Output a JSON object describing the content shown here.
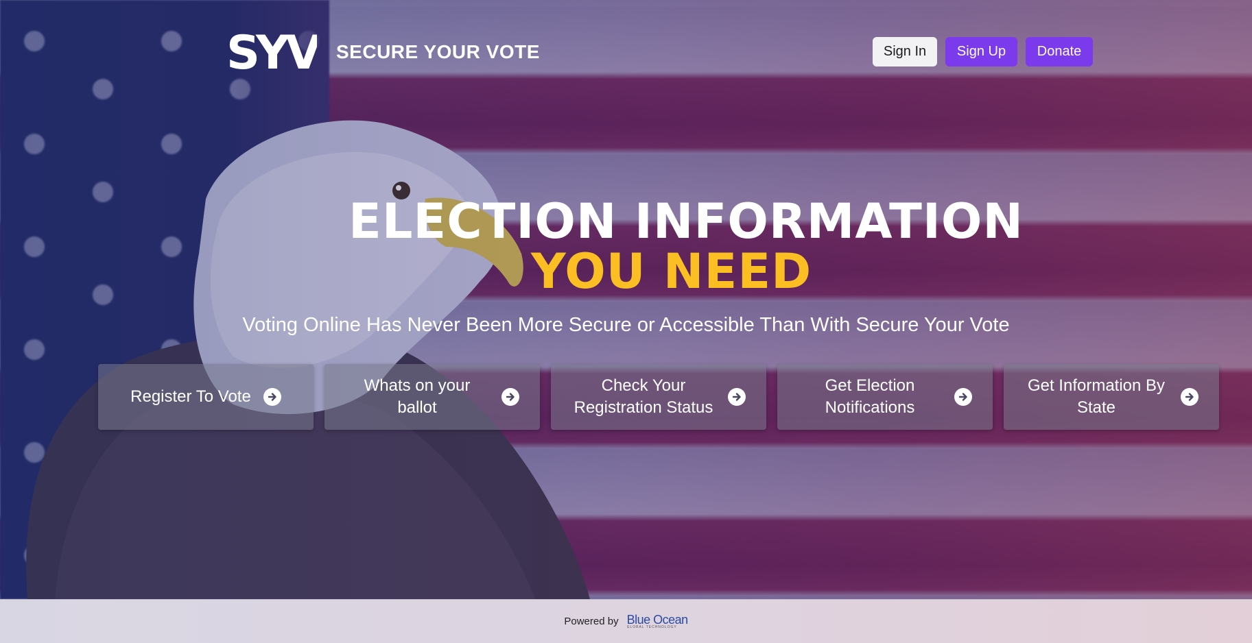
{
  "header": {
    "logo_text": "SYV",
    "brand_name": "SECURE YOUR VOTE",
    "nav": {
      "sign_in": "Sign In",
      "sign_up": "Sign Up",
      "donate": "Donate"
    }
  },
  "hero": {
    "title_line1": "ELECTION INFORMATION",
    "title_line2": "YOU NEED",
    "subtitle": "Voting Online Has Never Been More Secure or Accessible Than With Secure Your Vote"
  },
  "cards": [
    {
      "label": "Register To Vote",
      "icon": "arrow-right-circle-icon"
    },
    {
      "label": "Whats on your ballot",
      "icon": "arrow-right-circle-icon"
    },
    {
      "label": "Check Your Registration Status",
      "icon": "arrow-right-circle-icon"
    },
    {
      "label": "Get Election Notifications",
      "icon": "arrow-right-circle-icon"
    },
    {
      "label": "Get Information By State",
      "icon": "arrow-right-circle-icon"
    }
  ],
  "footer": {
    "powered_by": "Powered by",
    "brand": "Blue Ocean",
    "brand_sub": "GLOBAL TECHNOLOGY"
  },
  "colors": {
    "primary": "#7c3aed",
    "accent_yellow": "#fbbf24",
    "canton_blue": "#1f2a63",
    "stripe_red": "#5d1f52",
    "footer_brand": "#2b4aa0"
  }
}
